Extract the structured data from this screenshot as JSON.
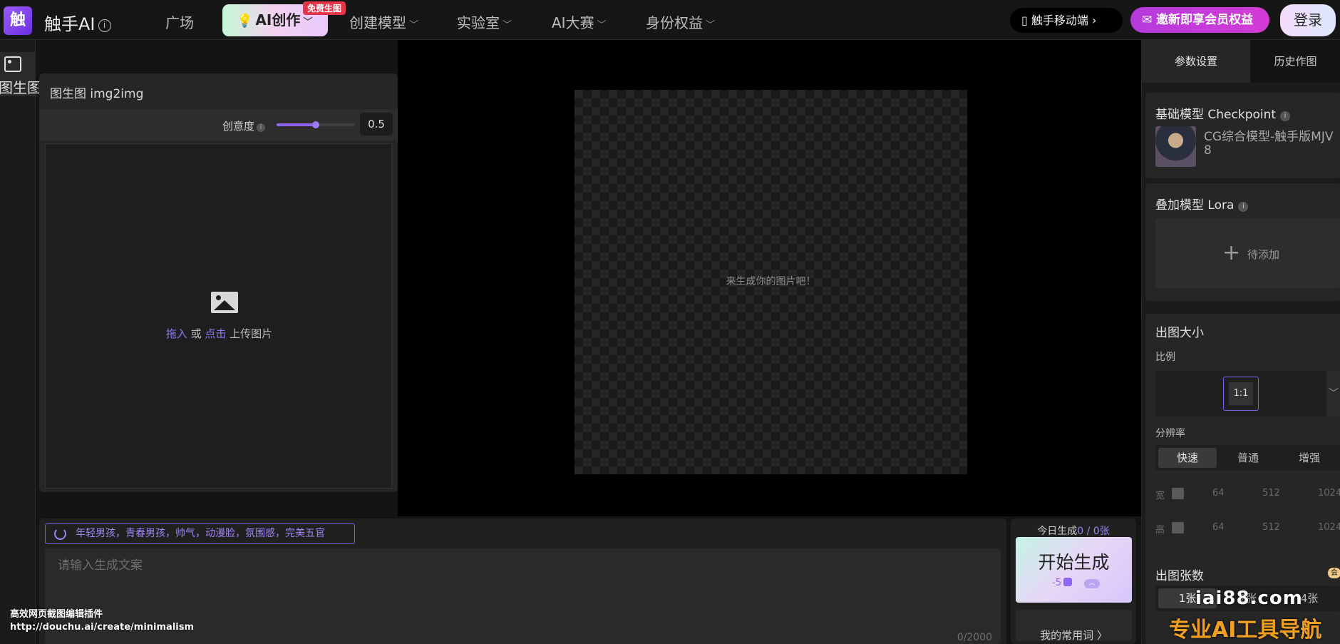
{
  "header": {
    "logo_text": "触",
    "brand": "触手AI",
    "nav": [
      {
        "label": "广场"
      },
      {
        "label": "AI创作"
      },
      {
        "label": "创建模型"
      },
      {
        "label": "实验室"
      },
      {
        "label": "AI大赛"
      },
      {
        "label": "身份权益"
      }
    ],
    "free_badge": "免费生图",
    "mobile_label": "触手移动端",
    "invite_label": "邀新即享会员权益",
    "login_label": "登录"
  },
  "left_rail": {
    "item_label": "图生图"
  },
  "img2img": {
    "title": "图生图 img2img",
    "creativity_label": "创意度",
    "creativity_value": "0.5",
    "creativity_level": 0.5,
    "upload_drag": "拖入",
    "upload_or": " 或 ",
    "upload_click": "点击",
    "upload_rest": " 上传图片"
  },
  "canvas": {
    "hint": "来生成你的图片吧！"
  },
  "prompt": {
    "suggestion": "年轻男孩，青春男孩，帅气，动漫脸，氛围感，完美五官",
    "placeholder": "请输入生成文案",
    "counter": "0/2000"
  },
  "generate": {
    "today_prefix": "今日生成",
    "today_count": "0 / 0张",
    "button_label": "开始生成",
    "cost": "-5",
    "common_words": "我的常用词 〉"
  },
  "settings": {
    "tabs": [
      {
        "label": "参数设置"
      },
      {
        "label": "历史作图"
      }
    ],
    "checkpoint_title": "基础模型 Checkpoint",
    "checkpoint_name": "CG综合模型-触手版MJV 8",
    "lora_title": "叠加模型 Lora",
    "lora_add": "待添加",
    "size_title": "出图大小",
    "ratio_label": "比例",
    "ratio_value": "1:1",
    "resolution_label": "分辨率",
    "resolution_options": [
      {
        "label": "快速"
      },
      {
        "label": "普通"
      },
      {
        "label": "增强"
      }
    ],
    "width_label": "宽",
    "height_label": "高",
    "dim_ticks": [
      "64",
      "512",
      "1024"
    ],
    "count_title": "出图张数",
    "count_options": [
      {
        "label": "1张"
      },
      {
        "label": "2张"
      },
      {
        "label": "4张"
      }
    ],
    "vip_badge": "会员"
  },
  "overlays": {
    "plugin_title": "高效网页截图编辑插件",
    "url": "http://douchu.ai/create/minimalism",
    "site": "iai88.com",
    "tagline": "专业AI工具导航"
  },
  "colors": {
    "accent": "#8f65f2",
    "background": "#141414",
    "panel": "#262626"
  }
}
